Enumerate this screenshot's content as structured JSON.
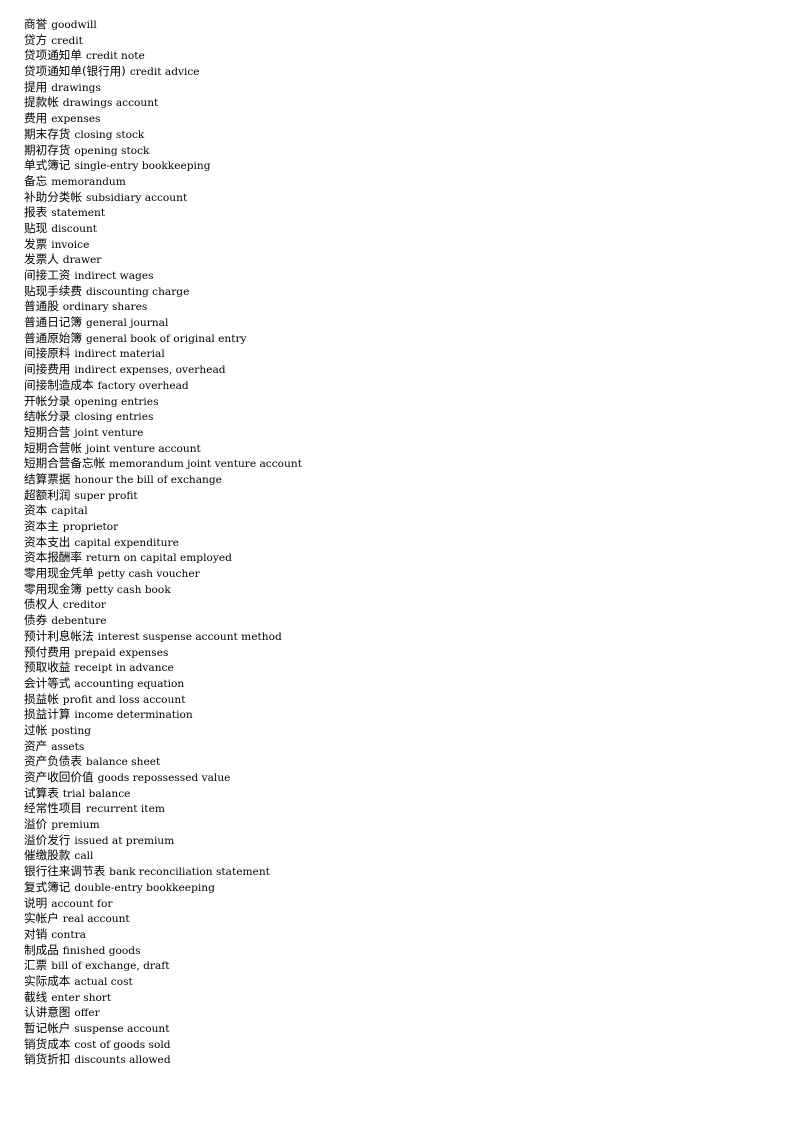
{
  "document": {
    "type": "bilingual-glossary",
    "subject": "accounting-terminology",
    "background_color": "#ffffff",
    "text_color": "#000000"
  },
  "entries": [
    {
      "zh": "商誉",
      "en": "goodwill"
    },
    {
      "zh": "贷方",
      "en": "credit"
    },
    {
      "zh": "贷项通知单",
      "en": "credit note"
    },
    {
      "zh": "贷项通知单(银行用)",
      "en": "credit advice"
    },
    {
      "zh": "提用",
      "en": "drawings"
    },
    {
      "zh": "提款帐",
      "en": "drawings account"
    },
    {
      "zh": "费用",
      "en": "expenses"
    },
    {
      "zh": "期末存货",
      "en": "closing stock"
    },
    {
      "zh": "期初存货",
      "en": "opening stock"
    },
    {
      "zh": "单式簿记",
      "en": "single-entry bookkeeping"
    },
    {
      "zh": "备忘",
      "en": "memorandum"
    },
    {
      "zh": "补助分类帐",
      "en": "subsidiary account"
    },
    {
      "zh": "报表",
      "en": "statement"
    },
    {
      "zh": "贴现",
      "en": "discount"
    },
    {
      "zh": "发票",
      "en": "invoice"
    },
    {
      "zh": "发票人",
      "en": "drawer"
    },
    {
      "zh": "间接工资",
      "en": "indirect wages"
    },
    {
      "zh": "贴现手续费",
      "en": "discounting charge"
    },
    {
      "zh": "普通股",
      "en": "ordinary shares"
    },
    {
      "zh": "普通日记簿",
      "en": "general journal"
    },
    {
      "zh": "普通原始簿",
      "en": "general book of original entry"
    },
    {
      "zh": "间接原料",
      "en": "indirect material"
    },
    {
      "zh": "间接费用",
      "en": "indirect expenses, overhead"
    },
    {
      "zh": "间接制造成本",
      "en": "factory overhead"
    },
    {
      "zh": "开帐分录",
      "en": "opening entries"
    },
    {
      "zh": "结帐分录",
      "en": "closing entries"
    },
    {
      "zh": "短期合营",
      "en": "joint venture"
    },
    {
      "zh": "短期合营帐",
      "en": "joint venture account"
    },
    {
      "zh": "短期合营备忘帐",
      "en": "memorandum joint venture account"
    },
    {
      "zh": "结算票据",
      "en": "honour the bill of exchange"
    },
    {
      "zh": "超额利润",
      "en": "super profit"
    },
    {
      "zh": "资本",
      "en": "capital"
    },
    {
      "zh": "资本主",
      "en": "proprietor"
    },
    {
      "zh": "资本支出",
      "en": "capital expenditure"
    },
    {
      "zh": "资本报酬率",
      "en": "return on capital employed"
    },
    {
      "zh": "零用现金凭单",
      "en": "petty cash voucher"
    },
    {
      "zh": "零用现金簿",
      "en": "petty cash book"
    },
    {
      "zh": "债权人",
      "en": "creditor"
    },
    {
      "zh": "债券",
      "en": "debenture"
    },
    {
      "zh": "预计利息帐法",
      "en": "interest suspense account method"
    },
    {
      "zh": "预付费用",
      "en": "prepaid expenses"
    },
    {
      "zh": "预取收益",
      "en": "receipt in advance"
    },
    {
      "zh": "会计等式",
      "en": "accounting equation"
    },
    {
      "zh": "损益帐",
      "en": "profit and loss account"
    },
    {
      "zh": "损益计算",
      "en": "income determination"
    },
    {
      "zh": "过帐",
      "en": "posting"
    },
    {
      "zh": "资产",
      "en": "assets"
    },
    {
      "zh": "资产负债表",
      "en": "balance sheet"
    },
    {
      "zh": "资产收回价值",
      "en": "goods repossessed value"
    },
    {
      "zh": "试算表",
      "en": "trial balance"
    },
    {
      "zh": "经常性项目",
      "en": "recurrent item"
    },
    {
      "zh": "溢价",
      "en": "premium"
    },
    {
      "zh": "溢价发行",
      "en": "issued at premium"
    },
    {
      "zh": "催缴股款",
      "en": "call"
    },
    {
      "zh": "银行往来调节表",
      "en": "bank reconciliation  statement"
    },
    {
      "zh": "复式簿记",
      "en": "double-entry bookkeeping"
    },
    {
      "zh": "说明",
      "en": "account for"
    },
    {
      "zh": "实帐户",
      "en": "real account"
    },
    {
      "zh": "对销",
      "en": "contra"
    },
    {
      "zh": "制成品",
      "en": "finished goods"
    },
    {
      "zh": "汇票",
      "en": "bill of exchange, draft"
    },
    {
      "zh": "实际成本",
      "en": "actual cost"
    },
    {
      "zh": "截线",
      "en": "enter short"
    },
    {
      "zh": "认讲意图",
      "en": "offer"
    },
    {
      "zh": "暂记帐户",
      "en": "suspense account"
    },
    {
      "zh": "销货成本",
      "en": "cost of goods sold"
    },
    {
      "zh": "销货折扣",
      "en": "discounts allowed"
    }
  ]
}
